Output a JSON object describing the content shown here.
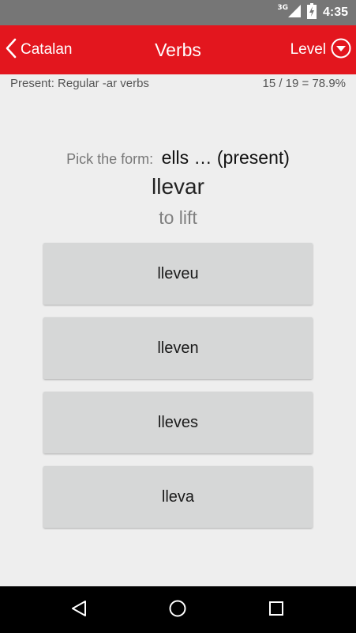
{
  "status_bar": {
    "network": "3G",
    "time": "4:35",
    "icons": [
      "signal-icon",
      "battery-charging-icon"
    ]
  },
  "app_bar": {
    "back_label": "Catalan",
    "title": "Verbs",
    "level_label": "Level",
    "color": "#e3161e"
  },
  "sub_header": {
    "lesson": "Present: Regular -ar verbs",
    "score": "15 / 19 = 78.9%"
  },
  "question": {
    "prompt_label": "Pick the form:",
    "form": "ells … (present)",
    "infinitive": "llevar",
    "translation": "to lift"
  },
  "options": [
    {
      "label": "lleveu"
    },
    {
      "label": "lleven"
    },
    {
      "label": "lleves"
    },
    {
      "label": "lleva"
    }
  ],
  "nav_bar": {
    "icons": [
      "back-nav-icon",
      "home-nav-icon",
      "recents-nav-icon"
    ]
  }
}
